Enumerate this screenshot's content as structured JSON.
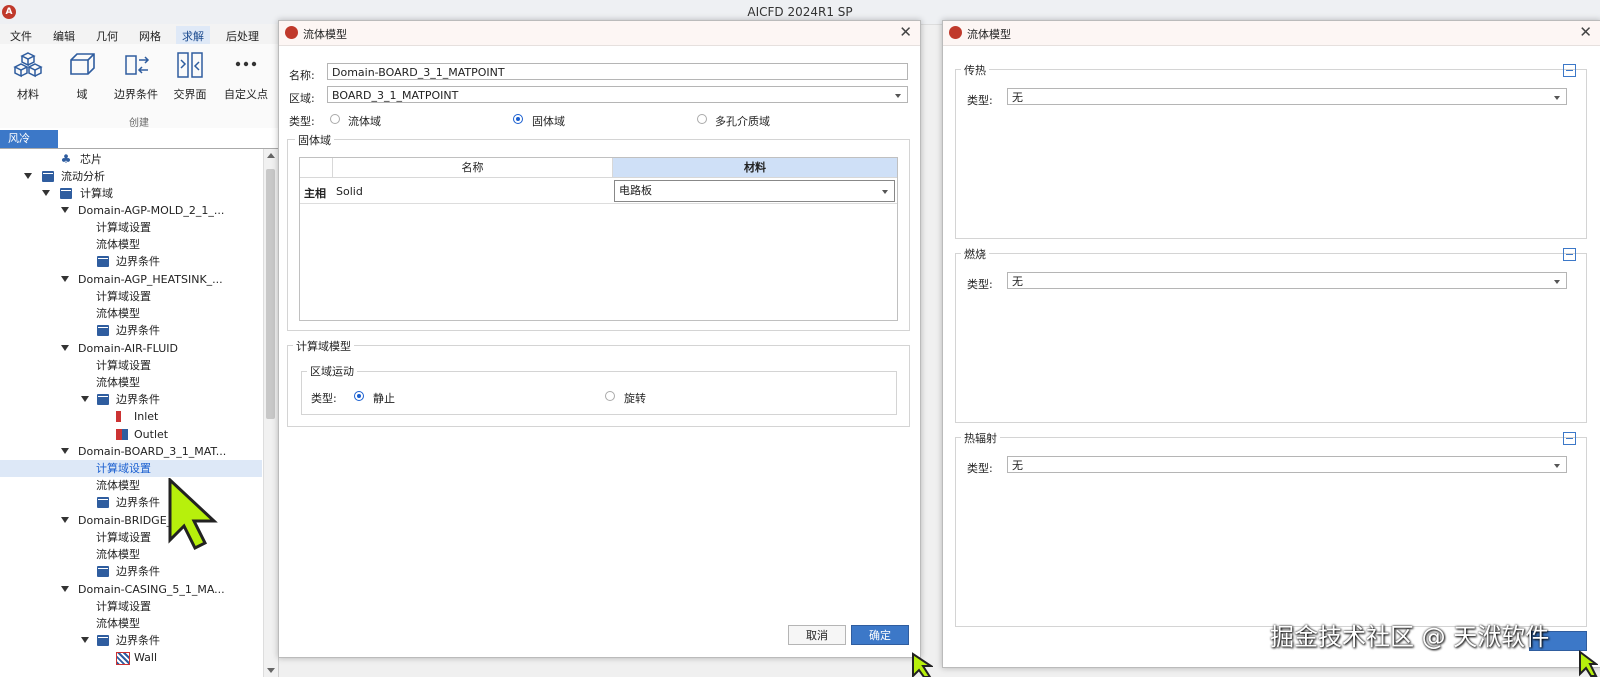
{
  "app": {
    "title": "AICFD 2024R1 SP"
  },
  "menu": {
    "items": [
      "文件",
      "编辑",
      "几何",
      "网格",
      "求解",
      "后处理"
    ],
    "active_index": 4
  },
  "ribbon": {
    "buttons": [
      "材料",
      "域",
      "边界条件",
      "交界面",
      "自定义点"
    ],
    "group_label": "创建"
  },
  "tree": {
    "tab": "风冷",
    "items": [
      "芯片",
      "流动分析",
      "计算域",
      "Domain-AGP-MOLD_2_1_...",
      "计算域设置",
      "流体模型",
      "边界条件",
      "Domain-AGP_HEATSINK_...",
      "计算域设置",
      "流体模型",
      "边界条件",
      "Domain-AIR-FLUID",
      "计算域设置",
      "流体模型",
      "边界条件",
      "Inlet",
      "Outlet",
      "Domain-BOARD_3_1_MAT...",
      "计算域设置",
      "流体模型",
      "边界条件",
      "Domain-BRIDGE_M",
      "计算域设置",
      "流体模型",
      "边界条件",
      "Domain-CASING_5_1_MA...",
      "计算域设置",
      "流体模型",
      "边界条件",
      "Wall"
    ]
  },
  "dialog1": {
    "title": "流体模型",
    "name_label": "名称:",
    "name_value": "Domain-BOARD_3_1_MATPOINT",
    "region_label": "区域:",
    "region_value": "BOARD_3_1_MATPOINT",
    "type_label": "类型:",
    "type_options": [
      "流体域",
      "固体域",
      "多孔介质域"
    ],
    "type_selected": "固体域",
    "solid_group": "固体域",
    "table": {
      "col_name": "名称",
      "col_material": "材料",
      "row_header": "主相",
      "row_name": "Solid",
      "row_material": "电路板"
    },
    "model_group": "计算域模型",
    "motion_group": "区域运动",
    "motion_type_label": "类型:",
    "motion_options": [
      "静止",
      "旋转"
    ],
    "motion_selected": "静止",
    "cancel": "取消",
    "ok": "确定"
  },
  "dialog2": {
    "title": "流体模型",
    "sections": [
      {
        "title": "传热",
        "type_label": "类型:",
        "value": "无"
      },
      {
        "title": "燃烧",
        "type_label": "类型:",
        "value": "无"
      },
      {
        "title": "热辐射",
        "type_label": "类型:",
        "value": "无"
      }
    ]
  },
  "watermark": "掘金技术社区 @ 天洑软件",
  "colors": {
    "accent": "#3c78c8",
    "brand": "#c0392b",
    "cursor": "#b7f00c"
  }
}
